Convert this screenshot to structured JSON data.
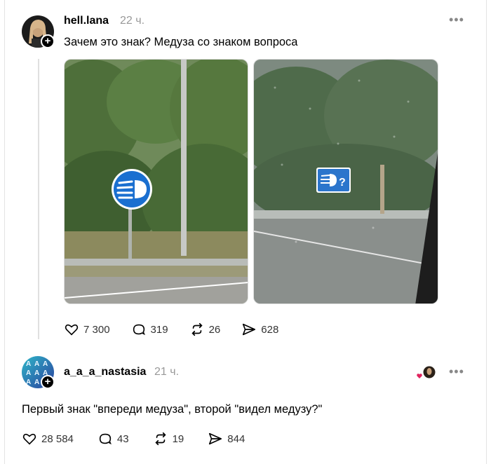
{
  "post1": {
    "username": "hell.lana",
    "time": "22 ч.",
    "text": "Зачем это знак? Медуза со знаком вопроса",
    "likes": "7 300",
    "comments": "319",
    "reposts": "26",
    "shares": "628"
  },
  "post2": {
    "username": "a_a_a_nastasia",
    "time": "21 ч.",
    "text": "Первый знак \"впереди медуза\", второй \"видел медузу?\"",
    "likes": "28 584",
    "comments": "43",
    "reposts": "19",
    "shares": "844"
  },
  "colors": {
    "sign_blue": "#1a6fd0",
    "liked_heart": "#e0245e"
  },
  "icons": [
    "heart-icon",
    "comment-icon",
    "repost-icon",
    "share-icon",
    "more-icon",
    "plus-icon"
  ]
}
